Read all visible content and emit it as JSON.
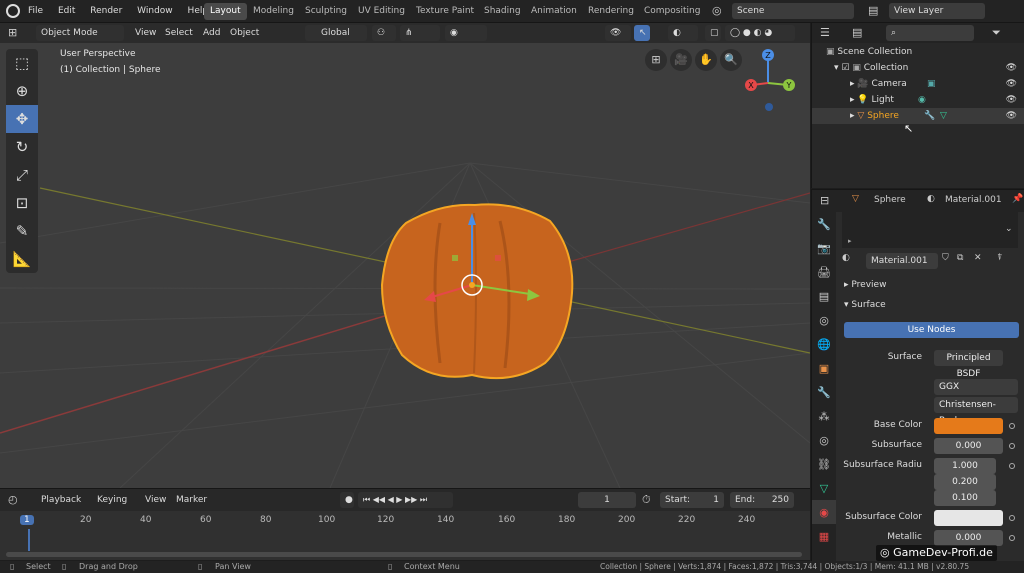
{
  "menu": [
    "File",
    "Edit",
    "Render",
    "Window",
    "Help"
  ],
  "workspaces": [
    {
      "label": "Layout",
      "active": true
    },
    {
      "label": "Modeling"
    },
    {
      "label": "Sculpting"
    },
    {
      "label": "UV Editing"
    },
    {
      "label": "Texture Paint"
    },
    {
      "label": "Shading"
    },
    {
      "label": "Animation"
    },
    {
      "label": "Rendering"
    },
    {
      "label": "Compositing"
    }
  ],
  "scene": "Scene",
  "view_layer": "View Layer",
  "viewport": {
    "mode": "Object Mode",
    "menus": [
      "View",
      "Select",
      "Add",
      "Object"
    ],
    "orientation": "Global",
    "info_line1": "User Perspective",
    "info_line2": "(1) Collection | Sphere",
    "gizmo": {
      "x": "X",
      "y": "Y",
      "z": "Z"
    }
  },
  "outliner": {
    "root": "Scene Collection",
    "collection": "Collection",
    "items": [
      "Camera",
      "Light",
      "Sphere"
    ]
  },
  "properties": {
    "object": "Sphere",
    "material": "Material.001",
    "slot_material": "Material.001",
    "panels": {
      "preview": "Preview",
      "surface": "Surface"
    },
    "use_nodes": "Use Nodes",
    "surface_label": "Surface",
    "surface_value": "Principled BSDF",
    "distribution": "GGX",
    "subsurface_method": "Christensen-Burl...",
    "base_color_label": "Base Color",
    "subsurface_label": "Subsurface",
    "subsurface_value": "0.000",
    "subsurface_radius_label": "Subsurface Radiu",
    "radius": [
      "1.000",
      "0.200",
      "0.100"
    ],
    "subsurface_color_label": "Subsurface Color",
    "metallic_label": "Metallic",
    "metallic_value": "0.000",
    "base_color": "#e57a1a",
    "subsurface_color": "#e6e6e6"
  },
  "timeline": {
    "menus": [
      "Playback",
      "Keying",
      "View",
      "Marker"
    ],
    "current_frame": "1",
    "start_label": "Start:",
    "start": "1",
    "end_label": "End:",
    "end": "250",
    "ruler": [
      "1",
      "20",
      "40",
      "60",
      "80",
      "100",
      "120",
      "140",
      "160",
      "180",
      "200",
      "220",
      "240"
    ]
  },
  "status": {
    "select": "Select",
    "drag": "Drag and Drop",
    "pan": "Pan View",
    "context": "Context Menu",
    "info": "Collection | Sphere | Verts:1,874 | Faces:1,872 | Tris:3,744 | Objects:1/3 | Mem: 41.1 MB | v2.80.75",
    "watermark": "GameDev-Profi.de"
  },
  "colors": {
    "accent": "#4772b3",
    "selection": "#f5a623"
  }
}
